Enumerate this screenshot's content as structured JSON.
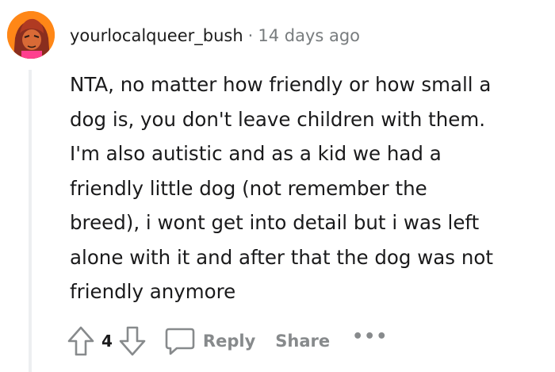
{
  "comment": {
    "username": "yourlocalqueer_bush",
    "separator": "·",
    "timestamp": "14 days ago",
    "body_lines": [
      "NTA, no matter how friendly or how small a",
      "dog is, you don't leave children with them.",
      "I'm also autistic and as a kid we had a",
      "friendly little dog (not remember the",
      "breed), i wont get into detail but i was left",
      "alone with it and after that the dog was not",
      "friendly anymore"
    ]
  },
  "actions": {
    "upvote_icon": "arrow-up-icon",
    "vote_count": "4",
    "downvote_icon": "arrow-down-icon",
    "reply_icon": "speech-bubble-icon",
    "reply_label": "Reply",
    "share_label": "Share",
    "more_label": "•••"
  },
  "colors": {
    "meta_gray": "#787c7e",
    "action_gray": "#878a8c",
    "text": "#1a1a1b",
    "thread_line": "#edeff1",
    "avatar_bg": "#ff8717"
  }
}
